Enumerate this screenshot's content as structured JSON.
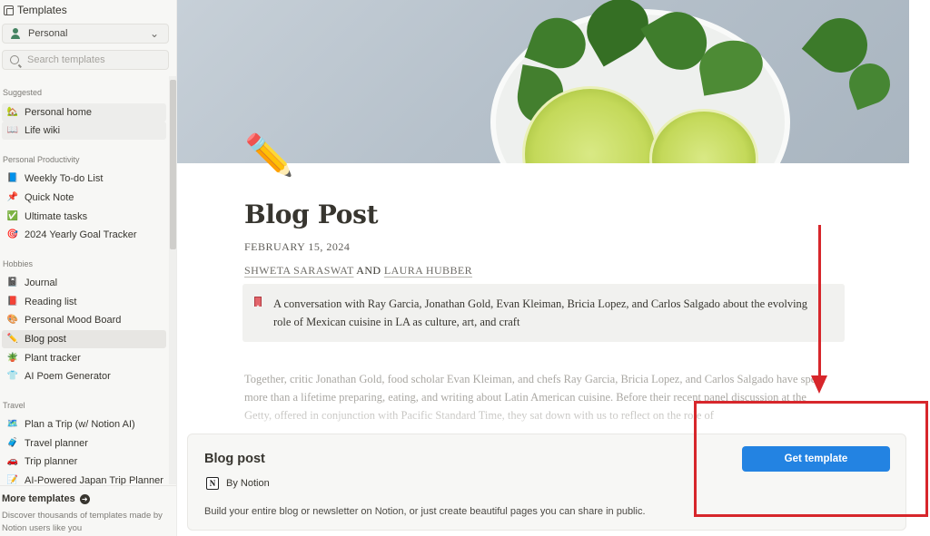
{
  "sidebar": {
    "title": "Templates",
    "workspace": "Personal",
    "search_placeholder": "Search templates",
    "sections": {
      "suggested": "Suggested",
      "productivity": "Personal Productivity",
      "hobbies": "Hobbies",
      "travel": "Travel"
    },
    "items": {
      "personal_home": "Personal home",
      "life_wiki": "Life wiki",
      "weekly_todo": "Weekly To-do List",
      "quick_note": "Quick Note",
      "ultimate_tasks": "Ultimate tasks",
      "goal_tracker": "2024 Yearly Goal Tracker",
      "journal": "Journal",
      "reading_list": "Reading list",
      "mood_board": "Personal Mood Board",
      "blog_post": "Blog post",
      "plant_tracker": "Plant tracker",
      "ai_poem": "AI Poem Generator",
      "plan_trip": "Plan a Trip (w/ Notion AI)",
      "travel_planner": "Travel planner",
      "trip_planner": "Trip planner",
      "japan_trip": "AI-Powered Japan Trip Planner"
    },
    "more_templates": {
      "title": "More templates",
      "description": "Discover thousands of templates made by Notion users like you"
    }
  },
  "page": {
    "emoji": "✏️",
    "title": "Blog Post",
    "date": "FEBRUARY 15, 2024",
    "author1": "SHWETA SARASWAT",
    "and_text": "AND",
    "author2": "LAURA HUBBER",
    "callout": "A conversation with Ray Garcia, Jonathan Gold, Evan Kleiman, Bricia Lopez, and Carlos Salgado about the evolving role of Mexican cuisine in LA as culture, art, and craft",
    "body": "Together, critic Jonathan Gold, food scholar Evan Kleiman, and chefs Ray Garcia, Bricia Lopez, and Carlos Salgado have spent more than a lifetime preparing, eating, and writing about Latin American cuisine. Before their recent panel discussion at the Getty, offered in conjunction with Pacific Standard Time, they sat down with us to reflect on the role of"
  },
  "template_card": {
    "name": "Blog post",
    "by": "By Notion",
    "description": "Build your entire blog or newsletter on Notion, or just create beautiful pages you can share in public.",
    "button": "Get template"
  },
  "colors": {
    "accent": "#2383e2",
    "annotation": "#d7262b",
    "sidebar_bg": "#f7f7f5",
    "callout_bg": "#f1f1ef"
  }
}
